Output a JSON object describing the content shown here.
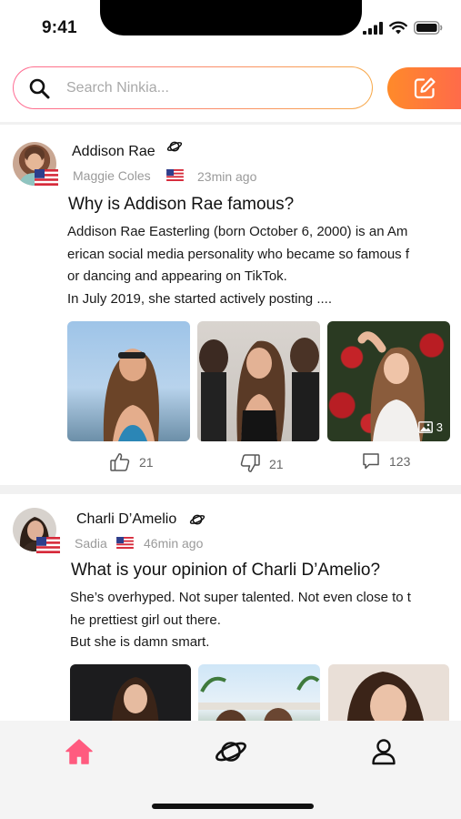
{
  "status_bar": {
    "time": "9:41"
  },
  "search": {
    "placeholder": "Search Ninkia..."
  },
  "colors": {
    "accent_pink": "#ff5b7f",
    "accent_orange": "#ff7a35"
  },
  "posts": [
    {
      "author": "Addison Rae",
      "sub_name": "Maggie Coles",
      "time_ago": "23min ago",
      "title": "Why is Addison Rae famous?",
      "body": "Addison Rae Easterling (born October 6, 2000) is an Am\nerican social media personality who became so famous f\nor dancing and appearing on TikTok.\nIn July 2019, she started actively posting ....",
      "photo_count": "3",
      "likes": "21",
      "dislikes": "21",
      "comments": "123"
    },
    {
      "author": "Charli D’Amelio",
      "sub_name": "Sadia",
      "time_ago": "46min ago",
      "title": "What is your opinion of Charli D’Amelio?",
      "body": "She’s overhyped. Not super talented. Not even close to t\nhe prettiest girl out there.\nBut she is damn smart."
    }
  ],
  "tabs": [
    {
      "icon": "home-icon",
      "active": true
    },
    {
      "icon": "planet-icon",
      "active": false
    },
    {
      "icon": "profile-icon",
      "active": false
    }
  ]
}
